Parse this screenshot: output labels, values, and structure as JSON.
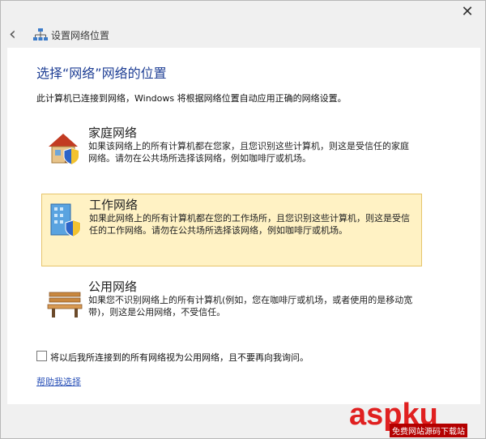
{
  "window": {
    "title": "设置网络位置",
    "close_symbol": "✕",
    "back_symbol": "‹"
  },
  "main": {
    "heading": "选择“网络”网络的位置",
    "description": "此计算机已连接到网络，Windows 将根据网络位置自动应用正确的网络设置。"
  },
  "options": [
    {
      "label": "家庭网络",
      "text": "如果该网络上的所有计算机都在您家，且您识别这些计算机，则这是受信任的家庭网络。请勿在公共场所选择该网络，例如咖啡厅或机场。",
      "icon": "house-shield-icon",
      "selected": false
    },
    {
      "label": "工作网络",
      "text": "如果此网络上的所有计算机都在您的工作场所，且您识别这些计算机，则这是受信任的工作网络。请勿在公共场所选择该网络，例如咖啡厅或机场。",
      "icon": "office-building-shield-icon",
      "selected": true
    },
    {
      "label": "公用网络",
      "text": "如果您不识别网络上的所有计算机(例如，您在咖啡厅或机场，或者使用的是移动宽带)，则这是公用网络，不受信任。",
      "icon": "park-bench-icon",
      "selected": false
    }
  ],
  "footer": {
    "checkbox_label": "将以后我所连接到的所有网络视为公用网络，且不要再向我询问。",
    "help_link": "帮助我选择"
  },
  "watermark": {
    "main": "aspku",
    "sub": "免费网站源码下载站"
  },
  "colors": {
    "accent_text": "#1f3f95",
    "selected_bg": "#fff2c4",
    "watermark": "#e02020"
  }
}
